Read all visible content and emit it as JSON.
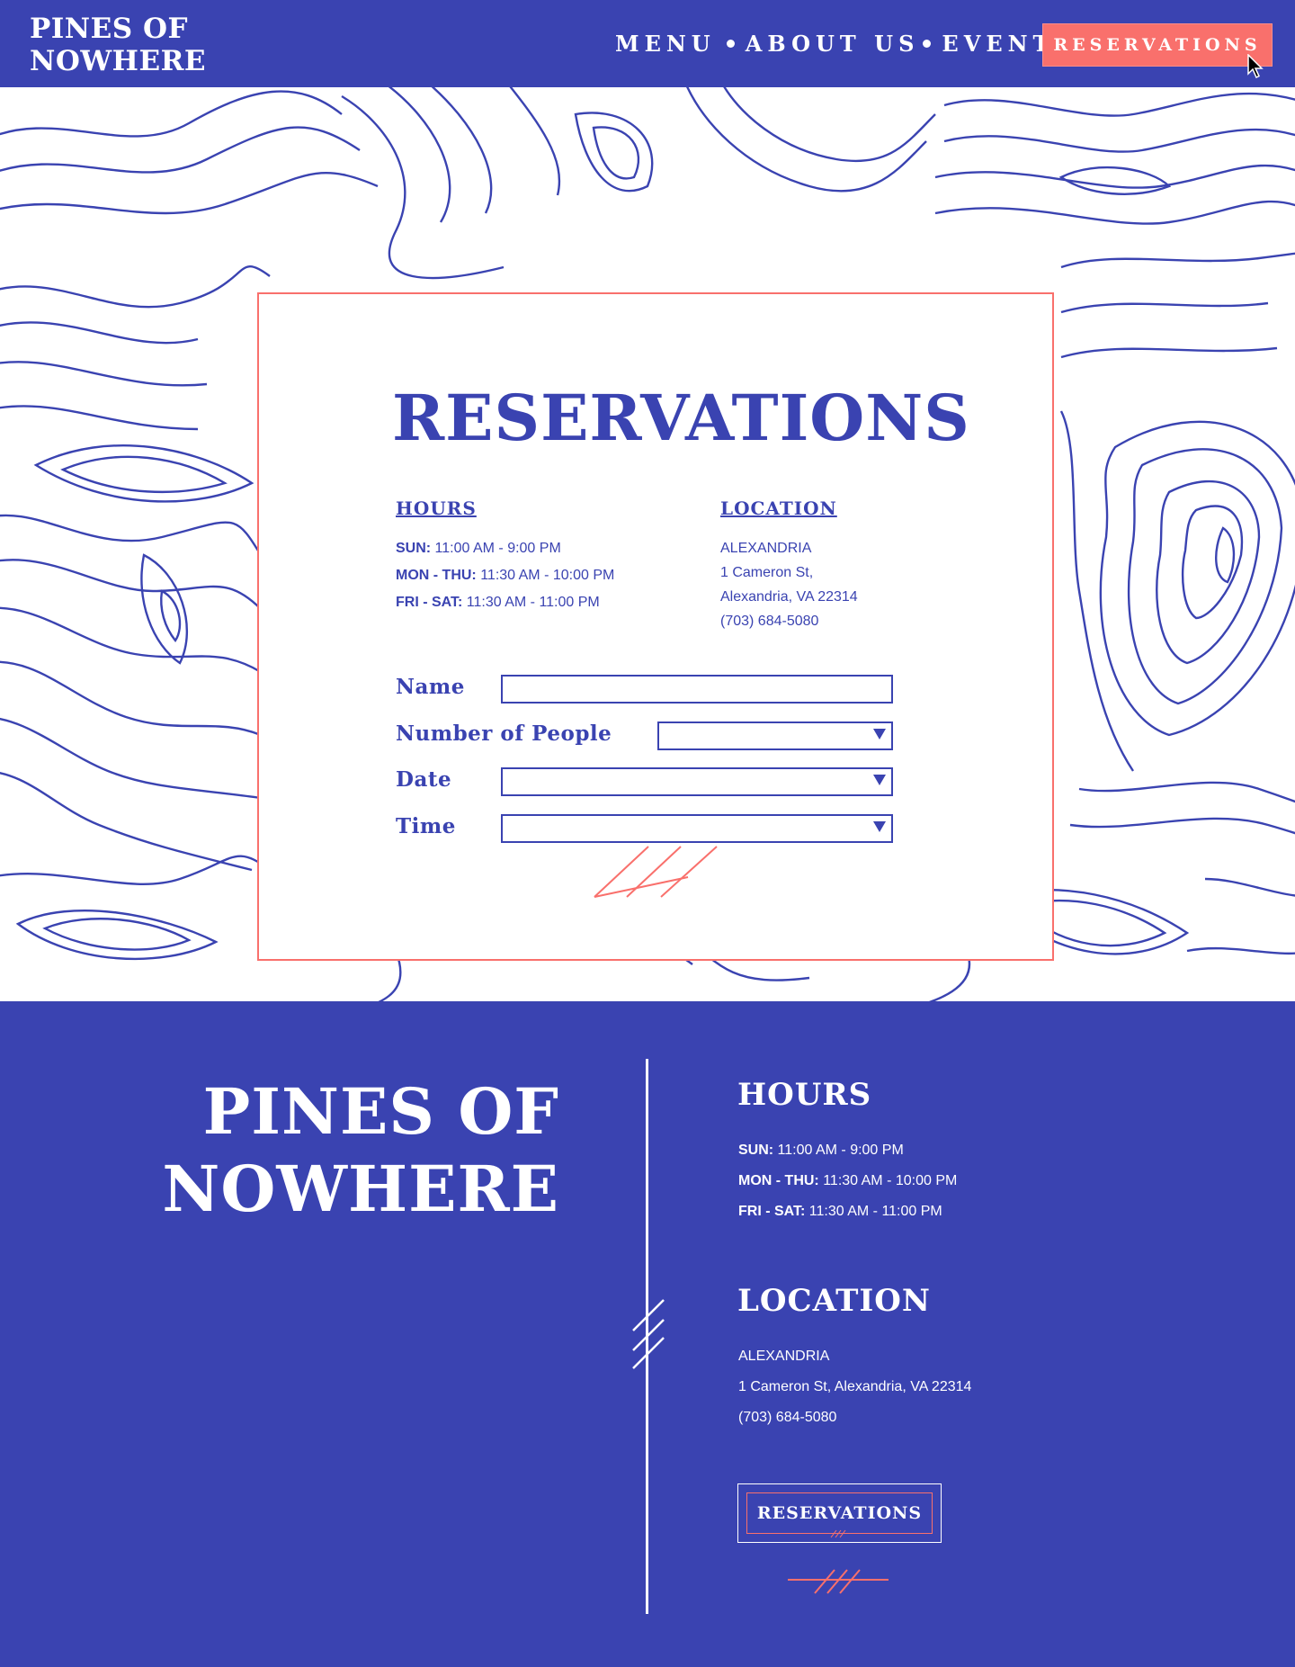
{
  "header": {
    "logo_line1": "PINES OF",
    "logo_line2": "NOWHERE",
    "nav": [
      {
        "label": "MENU"
      },
      {
        "label": "ABOUT US"
      },
      {
        "label": "EVENTS"
      }
    ],
    "cta_label": "RESERVATIONS"
  },
  "reservation_card": {
    "title": "RESERVATIONS",
    "hours": {
      "heading": "HOURS",
      "rows": [
        {
          "day": "SUN:",
          "time": " 11:00 AM - 9:00 PM"
        },
        {
          "day": "MON - THU:",
          "time": " 11:30 AM - 10:00 PM"
        },
        {
          "day": "FRI - SAT:",
          "time": " 11:30 AM - 11:00 PM"
        }
      ]
    },
    "location": {
      "heading": "LOCATION",
      "lines": [
        "ALEXANDRIA",
        "1 Cameron St,",
        "Alexandria, VA 22314",
        "(703) 684-5080"
      ]
    },
    "form": {
      "name_label": "Name",
      "people_label": "Number of People",
      "date_label": "Date",
      "time_label": "Time"
    }
  },
  "footer": {
    "logo_line1": "PINES OF",
    "logo_line2": "NOWHERE",
    "hours_heading": "HOURS",
    "hours": [
      {
        "day": "SUN:",
        "time": " 11:00 AM - 9:00 PM"
      },
      {
        "day": "MON - THU:",
        "time": " 11:30 AM - 10:00 PM"
      },
      {
        "day": "FRI - SAT:",
        "time": " 11:30 AM - 11:00 PM"
      }
    ],
    "location_heading": "LOCATION",
    "location_lines": [
      "ALEXANDRIA",
      "1 Cameron St, Alexandria, VA 22314",
      "(703) 684-5080"
    ],
    "button_label": "RESERVATIONS"
  },
  "colors": {
    "brand_blue": "#3a43b1",
    "accent_coral": "#f9706c",
    "background_white": "#ffffff"
  }
}
